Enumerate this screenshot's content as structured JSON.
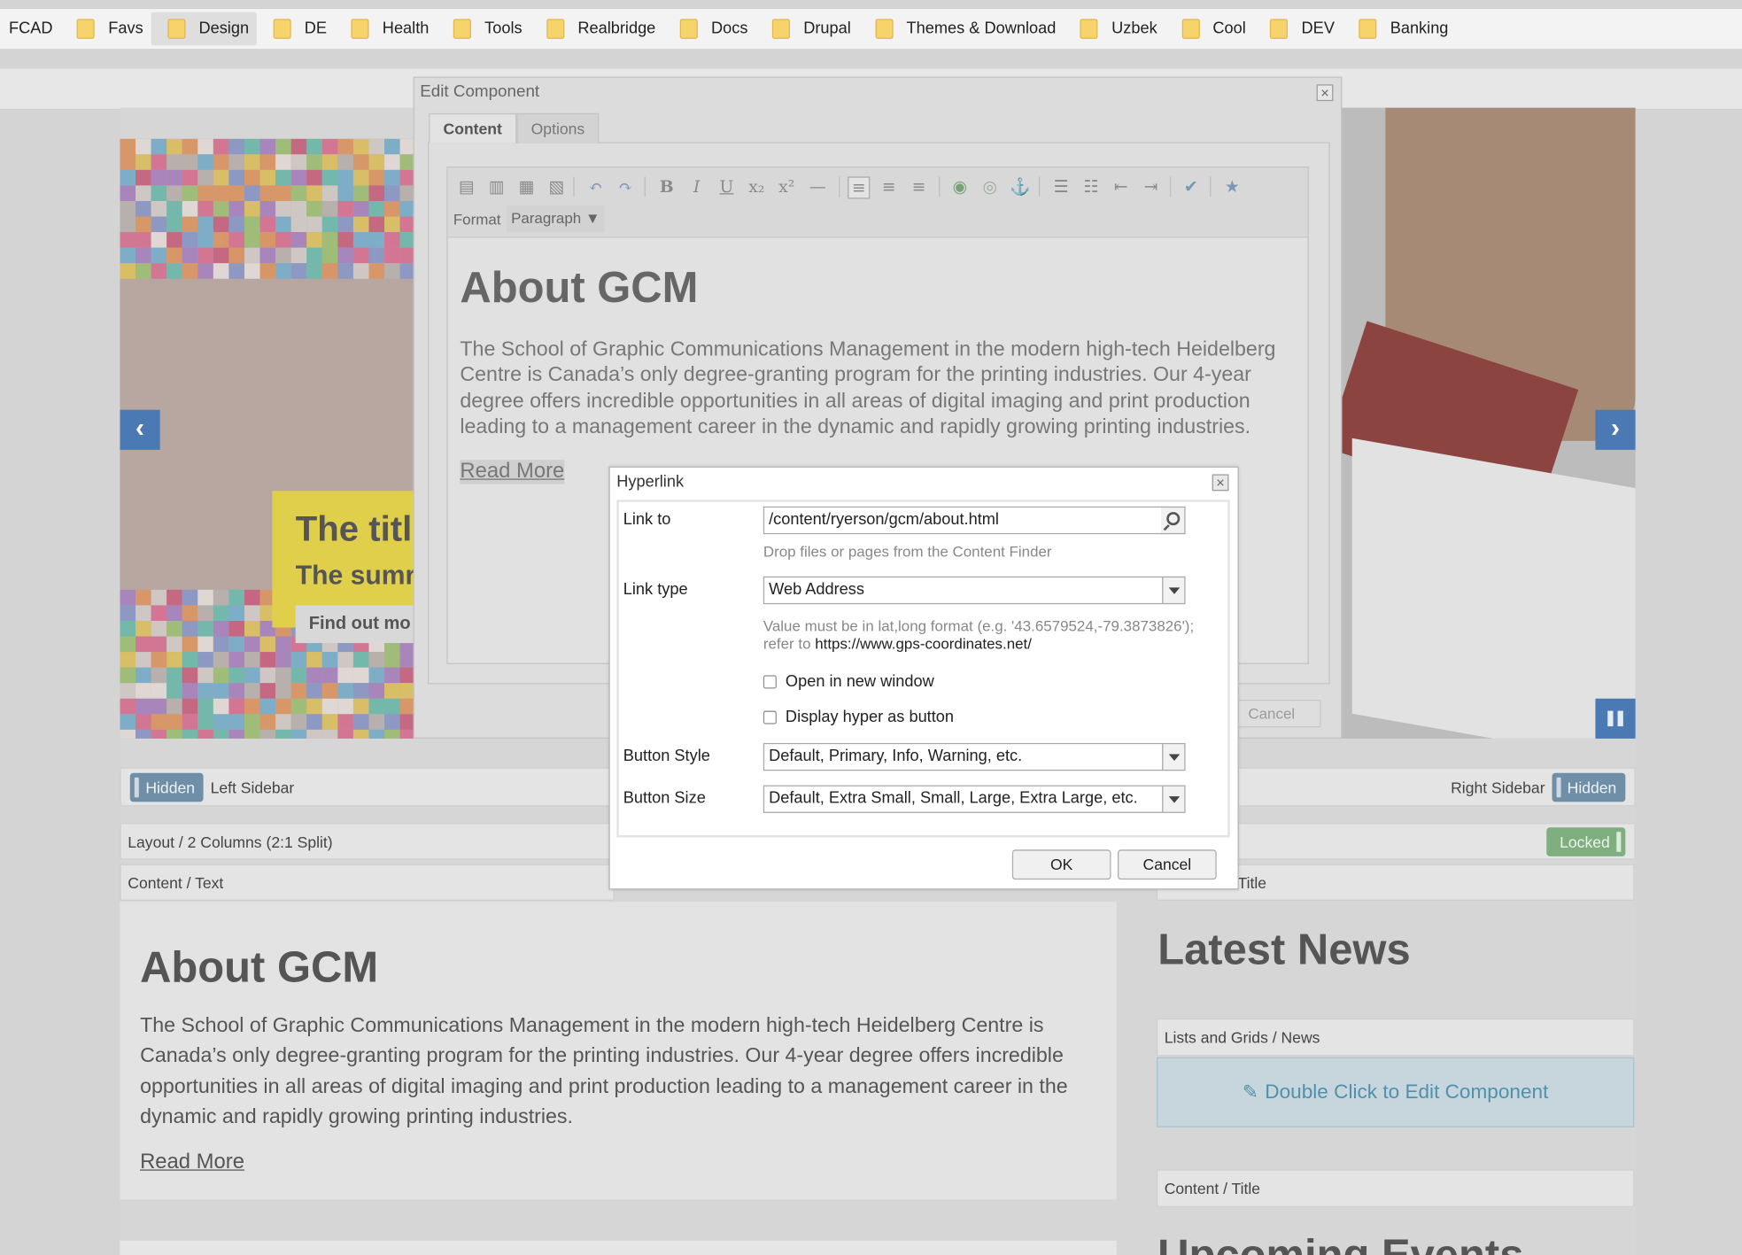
{
  "bookmarks": [
    {
      "label": "FCAD"
    },
    {
      "label": "Favs"
    },
    {
      "label": "Design"
    },
    {
      "label": "DE"
    },
    {
      "label": "Health"
    },
    {
      "label": "Tools"
    },
    {
      "label": "Realbridge"
    },
    {
      "label": "Docs"
    },
    {
      "label": "Drupal"
    },
    {
      "label": "Themes & Download"
    },
    {
      "label": "Uzbek"
    },
    {
      "label": "Cool"
    },
    {
      "label": "DEV"
    },
    {
      "label": "Banking"
    }
  ],
  "slider": {
    "title": "The titl",
    "summary": "The sumr",
    "button": "Find out mo",
    "prev_icon": "‹",
    "next_icon": "›"
  },
  "sidebars": {
    "left_toggle": "Hidden",
    "left_label": "Left Sidebar",
    "right_label": "Right Sidebar",
    "right_toggle": "Hidden"
  },
  "layout_bar": {
    "label": "Layout / 2 Columns (2:1 Split)",
    "locked": "Locked"
  },
  "content_text_bar": "Content / Text",
  "main": {
    "heading": "About GCM",
    "body": "The School of Graphic Communications Management in the modern high-tech Heidelberg Centre is Canada’s only degree-granting program for the printing industries. Our 4-year degree offers incredible opportunities in all areas of digital imaging and print production leading to a management career in the dynamic and rapidly growing printing industries.",
    "link": "Read More"
  },
  "right_col": {
    "title_bar_1": "Title",
    "news_heading": "Latest News",
    "news_bar": "Lists and Grids / News",
    "edit_prompt": "Double Click to Edit Component",
    "title_bar_2": "Content / Title",
    "events_heading": "Upcoming Events"
  },
  "edit_dialog": {
    "title": "Edit Component",
    "close": "×",
    "tabs": [
      {
        "label": "Content"
      },
      {
        "label": "Options"
      }
    ],
    "format_label": "Format",
    "format_value": "Paragraph ▼",
    "heading": "About GCM",
    "body": "The School of Graphic Communications Management in the modern high-tech Heidelberg Centre is Canada’s only degree-granting program for the printing industries. Our 4-year degree offers incredible opportunities in all areas of digital imaging and print production leading to a management career in the dynamic and rapidly growing printing industries.",
    "link": "Read More",
    "cancel": "Cancel"
  },
  "hyperlink_dialog": {
    "title": "Hyperlink",
    "close": "×",
    "link_to_label": "Link to",
    "link_to_value": "/content/ryerson/gcm/about.html",
    "link_to_help": "Drop files or pages from the Content Finder",
    "link_type_label": "Link type",
    "link_type_value": "Web Address",
    "link_type_help_1": "Value must be in lat,long format (e.g. '43.6579524,-79.3873826');",
    "link_type_help_2a": "refer to ",
    "link_type_help_2b": "https://www.gps-coordinates.net/",
    "open_new_window": "Open in new window",
    "display_as_button": "Display hyper as button",
    "button_style_label": "Button Style",
    "button_style_value": "Default, Primary, Info, Warning, etc.",
    "button_size_label": "Button Size",
    "button_size_value": "Default, Extra Small, Small, Large, Extra Large, etc.",
    "ok": "OK",
    "cancel": "Cancel"
  }
}
